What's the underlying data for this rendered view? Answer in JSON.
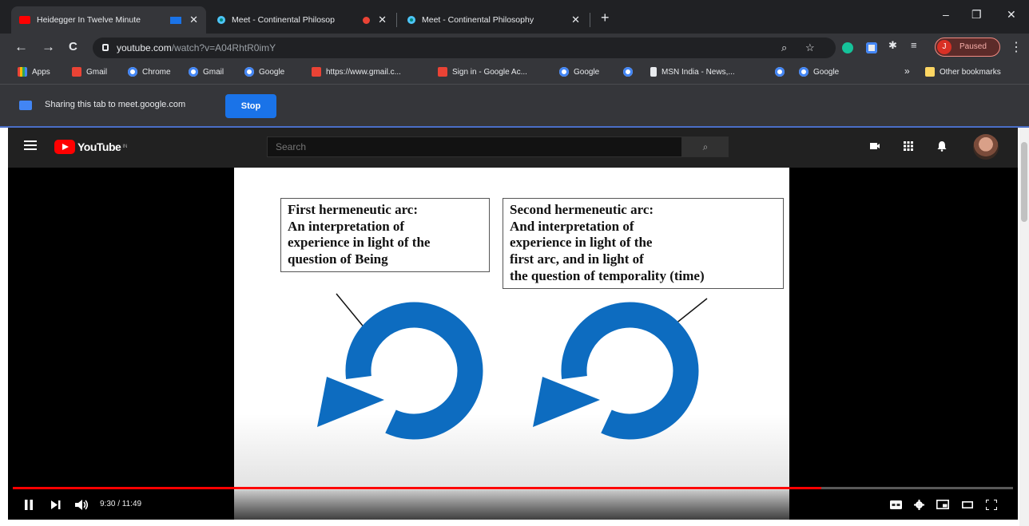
{
  "tabs": [
    {
      "title": "Heidegger In Twelve Minute",
      "favicon": "youtube-icon",
      "sharing": true
    },
    {
      "title": "Meet - Continental Philosop",
      "favicon": "meet-icon",
      "recording": true
    },
    {
      "title": "Meet - Continental Philosophy",
      "favicon": "meet-icon"
    }
  ],
  "window_controls": {
    "minimize": "–",
    "maximize": "❐",
    "close": "✕"
  },
  "toolbar": {
    "back": "←",
    "forward": "→",
    "reload": "C",
    "url_host": "youtube.com",
    "url_path": "/watch?v=A04RhtR0imY",
    "profile_initial": "J",
    "profile_status": "Paused",
    "menu": "⋮"
  },
  "bookmarks": [
    {
      "label": "Apps",
      "icon": "apps-grid-icon"
    },
    {
      "label": "Gmail",
      "icon": "gmail-icon"
    },
    {
      "label": "Chrome",
      "icon": "google-icon"
    },
    {
      "label": "Gmail",
      "icon": "google-icon"
    },
    {
      "label": "Google",
      "icon": "google-icon"
    },
    {
      "label": "https://www.gmail.c...",
      "icon": "gmail-icon"
    },
    {
      "label": "Sign in - Google Ac...",
      "icon": "gmail-icon"
    },
    {
      "label": "Google",
      "icon": "google-icon"
    },
    {
      "label": "",
      "icon": "google-icon"
    },
    {
      "label": "MSN India - News,...",
      "icon": "msn-icon"
    },
    {
      "label": "",
      "icon": "google-icon"
    },
    {
      "label": "Google",
      "icon": "google-icon"
    }
  ],
  "bookmarks_overflow": "»",
  "other_bookmarks": "Other bookmarks",
  "sharing_bar": {
    "text": "Sharing this tab to meet.google.com",
    "stop_label": "Stop"
  },
  "youtube": {
    "logo_text": "YouTube",
    "logo_sup": "IN",
    "search_placeholder": "Search",
    "search_button": "⌕"
  },
  "slide": {
    "callout_left": [
      "First hermeneutic arc:",
      "An interpretation of",
      "experience in light of the",
      "question of Being"
    ],
    "callout_right": [
      "Second hermeneutic arc:",
      "And interpretation of",
      "experience in light of the",
      "first arc, and in light of",
      "the question of temporality (time)"
    ],
    "arrow_color": "#0d6cc0"
  },
  "player": {
    "time_display": "9:30 / 11:49",
    "progress_fraction": 0.808
  }
}
